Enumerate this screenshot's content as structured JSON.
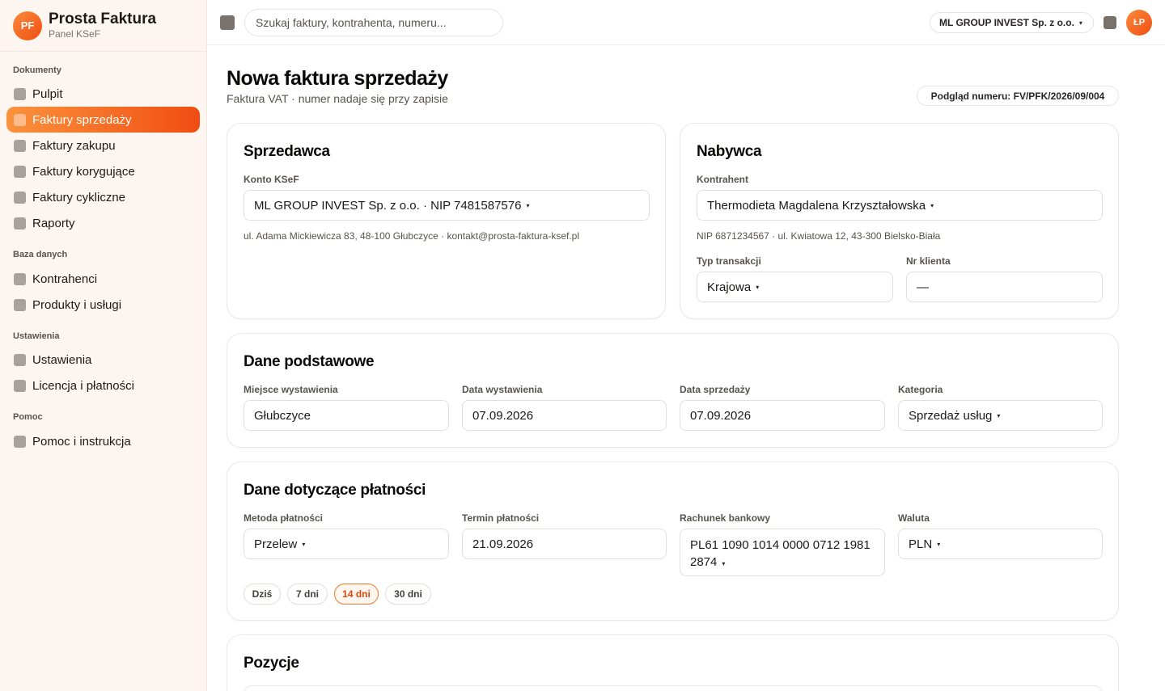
{
  "brand": {
    "logo": "PF",
    "title": "Prosta Faktura",
    "subtitle": "Panel KSeF"
  },
  "nav": {
    "sections": {
      "dokumenty": "Dokumenty",
      "baza": "Baza danych",
      "ustawienia": "Ustawienia",
      "pomoc": "Pomoc"
    },
    "items": [
      {
        "label": "Pulpit"
      },
      {
        "label": "Faktury sprzedaży"
      },
      {
        "label": "Faktury zakupu"
      },
      {
        "label": "Faktury korygujące"
      },
      {
        "label": "Faktury cykliczne"
      },
      {
        "label": "Raporty"
      },
      {
        "label": "Kontrahenci"
      },
      {
        "label": "Produkty i usługi"
      },
      {
        "label": "Ustawienia"
      },
      {
        "label": "Licencja i płatności"
      },
      {
        "label": "Pomoc i instrukcja"
      }
    ],
    "active_index": 1
  },
  "topbar": {
    "search_placeholder": "Szukaj faktury, kontrahenta, numeru...",
    "company": "ML GROUP INVEST Sp. z o.o.",
    "avatar": "ŁP"
  },
  "page": {
    "title": "Nowa faktura sprzedaży",
    "subtitle": "Faktura VAT · numer nadaje się przy zapisie",
    "preview": "Podgląd numeru: FV/PFK/2026/09/004"
  },
  "seller": {
    "title": "Sprzedawca",
    "account_label": "Konto KSeF",
    "account_value": "ML GROUP INVEST Sp. z o.o. · NIP 7481587576",
    "address": "ul. Adama Mickiewicza 83, 48-100 Głubczyce · kontakt@prosta-faktura-ksef.pl"
  },
  "buyer": {
    "title": "Nabywca",
    "contractor_label": "Kontrahent",
    "contractor_value": "Thermodieta Magdalena Krzyształowska",
    "details": "NIP 6871234567 · ul. Kwiatowa 12, 43-300 Bielsko-Biała",
    "transaction_label": "Typ transakcji",
    "transaction_value": "Krajowa",
    "client_no_label": "Nr klienta",
    "client_no_value": "—"
  },
  "basic": {
    "title": "Dane podstawowe",
    "place_label": "Miejsce wystawienia",
    "place_value": "Głubczyce",
    "issue_label": "Data wystawienia",
    "issue_value": "07.09.2026",
    "sale_label": "Data sprzedaży",
    "sale_value": "07.09.2026",
    "category_label": "Kategoria",
    "category_value": "Sprzedaż usług"
  },
  "payment": {
    "title": "Dane dotyczące płatności",
    "method_label": "Metoda płatności",
    "method_value": "Przelew",
    "due_label": "Termin płatności",
    "due_value": "21.09.2026",
    "account_label": "Rachunek bankowy",
    "account_line1": "PL61 1090 1014 0000 0712 1981",
    "account_line2": "2874",
    "currency_label": "Waluta",
    "currency_value": "PLN",
    "chips": [
      "Dziś",
      "7 dni",
      "14 dni",
      "30 dni"
    ],
    "active_chip": "14 dni"
  },
  "positions": {
    "title": "Pozycje"
  },
  "caret": "▾",
  "colors": {
    "accent": "#f04d12",
    "accent_light": "#fb923c",
    "sidebar_bg": "#fdf6f0"
  }
}
